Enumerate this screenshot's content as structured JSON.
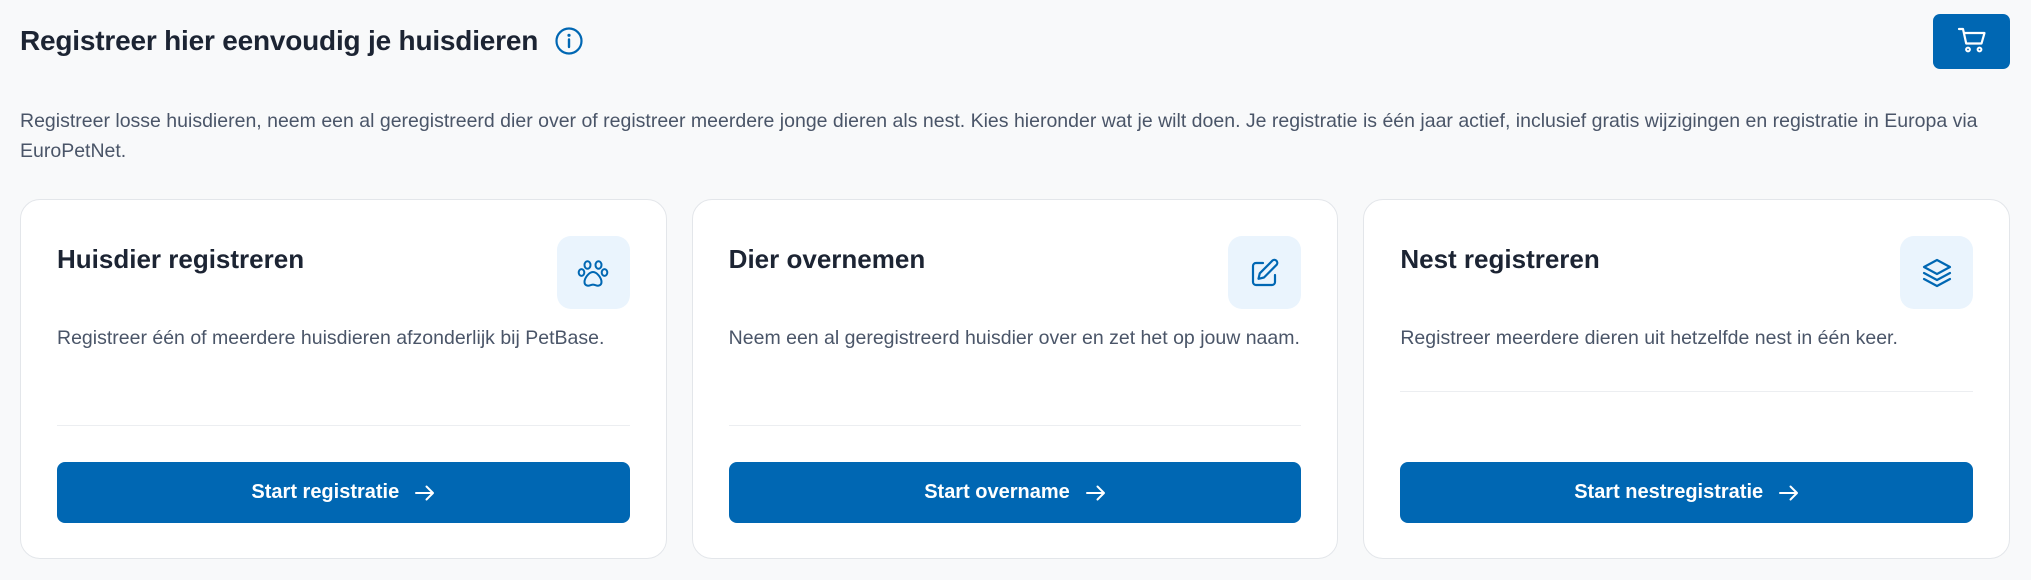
{
  "header": {
    "title": "Registreer hier eenvoudig je huisdieren",
    "info_icon": "info-circle-icon",
    "cart_icon": "shopping-cart-icon"
  },
  "intro": {
    "text": "Registreer losse huisdieren, neem een al geregistreerd dier over of registreer meerdere jonge dieren als nest. Kies hieronder wat je wilt doen. Je registratie is één jaar actief, inclusief gratis wijzigingen en registratie in Europa via EuroPetNet."
  },
  "cards": [
    {
      "title": "Huisdier registreren",
      "icon": "paw-icon",
      "description": "Registreer één of meerdere huisdieren afzonderlijk bij PetBase.",
      "button_label": "Start registratie"
    },
    {
      "title": "Dier overnemen",
      "icon": "edit-icon",
      "description": "Neem een al geregistreerd huisdier over en zet het op jouw naam.",
      "button_label": "Start overname"
    },
    {
      "title": "Nest registreren",
      "icon": "layers-icon",
      "description": "Registreer meerdere dieren uit hetzelfde nest in één keer.",
      "button_label": "Start nestregistratie"
    }
  ],
  "colors": {
    "primary": "#0067b3",
    "background": "#f8f9fa",
    "card_background": "#ffffff",
    "icon_tile": "#eaf4fd",
    "text_dark": "#1c2433",
    "text_muted": "#4a5568"
  }
}
